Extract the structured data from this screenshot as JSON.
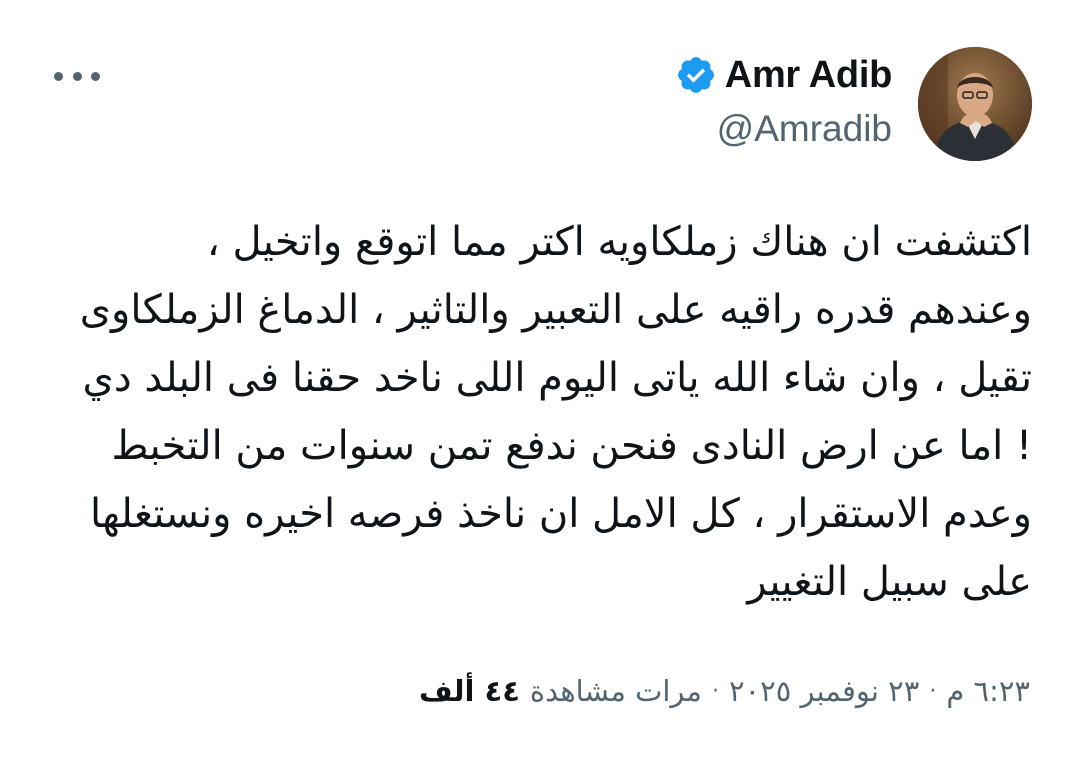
{
  "author": {
    "display_name": "Amr Adib",
    "handle": "@Amradib",
    "verified": true,
    "verified_color": "#1d9bf0",
    "avatar": "profile-photo"
  },
  "tweet": {
    "lines": [
      "اكتشفت ان هناك زملكاويه اكتر مما اتوقع واتخيل ،",
      "وعندهم قدره راقيه على التعبير والتاثير ، الدماغ الزملكاوى",
      "تقيل ، وان شاء الله ياتى اليوم اللى ناخد حقنا فى البلد دي",
      "! اما عن ارض النادى فنحن ندفع تمن سنوات من التخبط",
      "وعدم الاستقرار ، كل الامل ان ناخذ فرصه اخيره ونستغلها",
      "على سبيل التغيير"
    ]
  },
  "meta": {
    "time": "٦:٢٣ م",
    "separator": "·",
    "date": "٢٣ نوفمبر ٢٠٢٥",
    "views_count": "٤٤ ألف",
    "views_label": "مرات مشاهدة"
  },
  "icons": {
    "more": "more-horizontal-icon",
    "verified": "verified-badge-icon"
  },
  "colors": {
    "text_primary": "#0f1419",
    "text_secondary": "#536471",
    "background": "#ffffff"
  }
}
